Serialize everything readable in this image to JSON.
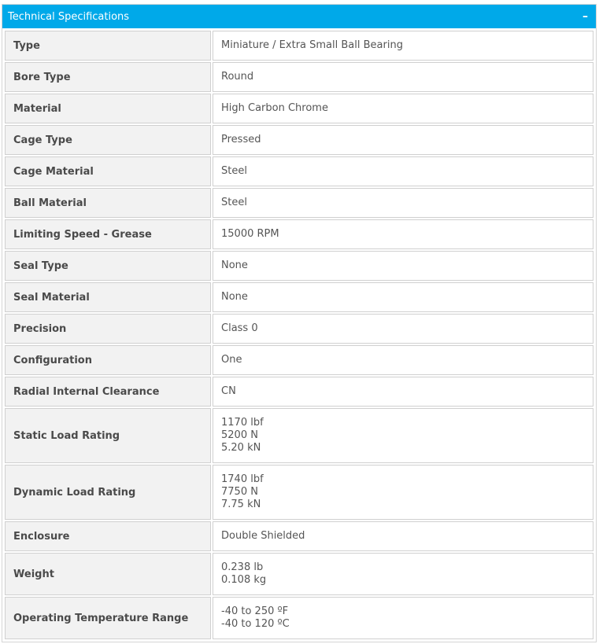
{
  "panel": {
    "title": "Technical Specifications",
    "collapse_symbol": "–"
  },
  "specs": [
    {
      "label": "Type",
      "values": [
        "Miniature / Extra Small Ball Bearing"
      ]
    },
    {
      "label": "Bore Type",
      "values": [
        "Round"
      ]
    },
    {
      "label": "Material",
      "values": [
        "High Carbon Chrome"
      ]
    },
    {
      "label": "Cage Type",
      "values": [
        "Pressed"
      ]
    },
    {
      "label": "Cage Material",
      "values": [
        "Steel"
      ]
    },
    {
      "label": "Ball Material",
      "values": [
        "Steel"
      ]
    },
    {
      "label": "Limiting Speed - Grease",
      "values": [
        "15000 RPM"
      ]
    },
    {
      "label": "Seal Type",
      "values": [
        "None"
      ]
    },
    {
      "label": "Seal Material",
      "values": [
        "None"
      ]
    },
    {
      "label": "Precision",
      "values": [
        "Class 0"
      ]
    },
    {
      "label": "Configuration",
      "values": [
        "One"
      ]
    },
    {
      "label": "Radial Internal Clearance",
      "values": [
        "CN"
      ]
    },
    {
      "label": "Static Load Rating",
      "values": [
        "1170 lbf",
        "5200 N",
        "5.20 kN"
      ]
    },
    {
      "label": "Dynamic Load Rating",
      "values": [
        "1740 lbf",
        "7750 N",
        "7.75 kN"
      ]
    },
    {
      "label": "Enclosure",
      "values": [
        "Double Shielded"
      ]
    },
    {
      "label": "Weight",
      "values": [
        "0.238 lb",
        "0.108 kg"
      ]
    },
    {
      "label": "Operating Temperature Range",
      "values": [
        "-40 to 250 ºF",
        "-40 to 120 ºC"
      ]
    }
  ]
}
